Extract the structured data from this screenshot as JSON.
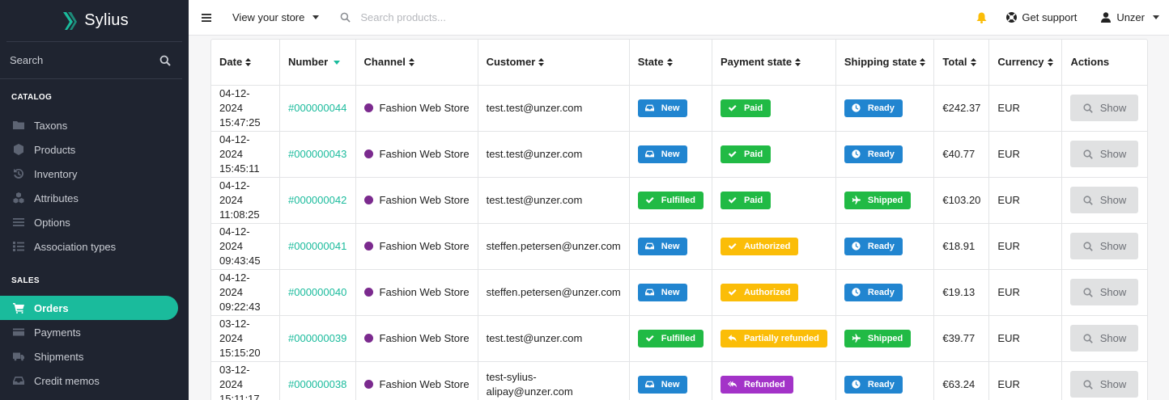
{
  "brand": {
    "name": "Sylius",
    "accent": "#1abb9c",
    "sidebar_bg": "#1f2430"
  },
  "sidebar": {
    "search_label": "Search",
    "sections": [
      {
        "label": "CATALOG",
        "items": [
          {
            "label": "Taxons",
            "icon": "folder-icon"
          },
          {
            "label": "Products",
            "icon": "cube-icon"
          },
          {
            "label": "Inventory",
            "icon": "history-icon"
          },
          {
            "label": "Attributes",
            "icon": "cubes-icon"
          },
          {
            "label": "Options",
            "icon": "options-icon"
          },
          {
            "label": "Association types",
            "icon": "tasks-icon"
          }
        ]
      },
      {
        "label": "SALES",
        "items": [
          {
            "label": "Orders",
            "icon": "cart-icon",
            "active": true
          },
          {
            "label": "Payments",
            "icon": "payment-icon"
          },
          {
            "label": "Shipments",
            "icon": "truck-icon"
          },
          {
            "label": "Credit memos",
            "icon": "inbox-icon"
          }
        ]
      }
    ]
  },
  "topbar": {
    "store_label": "View your store",
    "search_placeholder": "Search products...",
    "support_label": "Get support",
    "user_label": "Unzer"
  },
  "table": {
    "columns": [
      "Date",
      "Number",
      "Channel",
      "Customer",
      "State",
      "Payment state",
      "Shipping state",
      "Total",
      "Currency",
      "Actions"
    ],
    "rows": [
      {
        "date": "04-12-2024",
        "time": "15:47:25",
        "number": "#000000044",
        "channel": "Fashion Web Store",
        "customer": "test.test@unzer.com",
        "state": "New",
        "payment": "Paid",
        "shipping": "Ready",
        "total": "€242.37",
        "currency": "EUR",
        "action": "Show"
      },
      {
        "date": "04-12-2024",
        "time": "15:45:11",
        "number": "#000000043",
        "channel": "Fashion Web Store",
        "customer": "test.test@unzer.com",
        "state": "New",
        "payment": "Paid",
        "shipping": "Ready",
        "total": "€40.77",
        "currency": "EUR",
        "action": "Show"
      },
      {
        "date": "04-12-2024",
        "time": "11:08:25",
        "number": "#000000042",
        "channel": "Fashion Web Store",
        "customer": "test.test@unzer.com",
        "state": "Fulfilled",
        "payment": "Paid",
        "shipping": "Shipped",
        "total": "€103.20",
        "currency": "EUR",
        "action": "Show"
      },
      {
        "date": "04-12-2024",
        "time": "09:43:45",
        "number": "#000000041",
        "channel": "Fashion Web Store",
        "customer": "steffen.petersen@unzer.com",
        "state": "New",
        "payment": "Authorized",
        "shipping": "Ready",
        "total": "€18.91",
        "currency": "EUR",
        "action": "Show"
      },
      {
        "date": "04-12-2024",
        "time": "09:22:43",
        "number": "#000000040",
        "channel": "Fashion Web Store",
        "customer": "steffen.petersen@unzer.com",
        "state": "New",
        "payment": "Authorized",
        "shipping": "Ready",
        "total": "€19.13",
        "currency": "EUR",
        "action": "Show"
      },
      {
        "date": "03-12-2024",
        "time": "15:15:20",
        "number": "#000000039",
        "channel": "Fashion Web Store",
        "customer": "test.test@unzer.com",
        "state": "Fulfilled",
        "payment": "Partially refunded",
        "shipping": "Shipped",
        "total": "€39.77",
        "currency": "EUR",
        "action": "Show"
      },
      {
        "date": "03-12-2024",
        "time": "15:11:17",
        "number": "#000000038",
        "channel": "Fashion Web Store",
        "customer": "test-sylius-alipay@unzer.com",
        "customer_lines": [
          "test-sylius-",
          "alipay@unzer.com"
        ],
        "state": "New",
        "payment": "Refunded",
        "shipping": "Ready",
        "total": "€63.24",
        "currency": "EUR",
        "action": "Show"
      }
    ],
    "channel_color": "#7b2a8e",
    "status_colors": {
      "New": "#2185d0",
      "Fulfilled": "#21ba45",
      "Paid": "#21ba45",
      "Authorized": "#fbbd08",
      "Partially refunded": "#fbbd08",
      "Refunded": "#a333c8",
      "Ready": "#2185d0",
      "Shipped": "#21ba45"
    }
  }
}
